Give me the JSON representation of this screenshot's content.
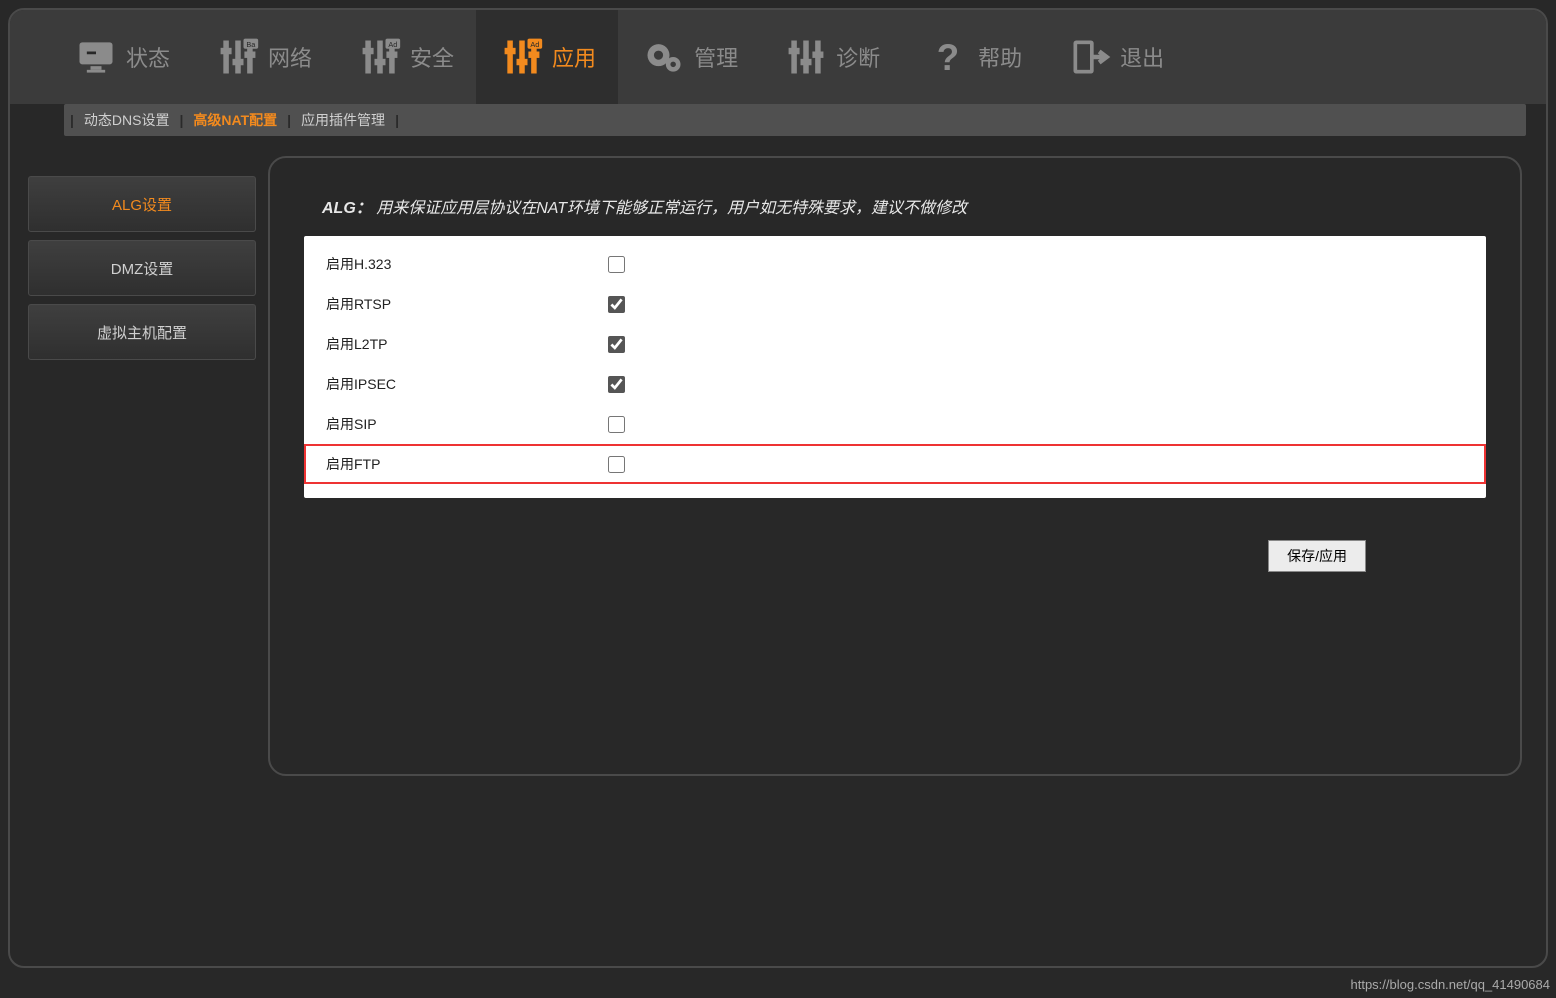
{
  "topnav": [
    {
      "label": "状态",
      "icon": "monitor"
    },
    {
      "label": "网络",
      "icon": "sliders-ba"
    },
    {
      "label": "安全",
      "icon": "sliders-ad"
    },
    {
      "label": "应用",
      "icon": "sliders-ad",
      "active": true
    },
    {
      "label": "管理",
      "icon": "gears"
    },
    {
      "label": "诊断",
      "icon": "sliders"
    },
    {
      "label": "帮助",
      "icon": "question"
    },
    {
      "label": "退出",
      "icon": "exit"
    }
  ],
  "subnav": [
    {
      "label": "动态DNS设置"
    },
    {
      "label": "高级NAT配置",
      "active": true
    },
    {
      "label": "应用插件管理"
    }
  ],
  "sidebar": [
    {
      "label": "ALG设置",
      "active": true
    },
    {
      "label": "DMZ设置"
    },
    {
      "label": "虚拟主机配置"
    }
  ],
  "hint_prefix": "ALG：",
  "hint_body": "用来保证应用层协议在NAT环境下能够正常运行，用户如无特殊要求，建议不做修改",
  "options": [
    {
      "label": "启用H.323",
      "checked": false
    },
    {
      "label": "启用RTSP",
      "checked": true
    },
    {
      "label": "启用L2TP",
      "checked": true
    },
    {
      "label": "启用IPSEC",
      "checked": true
    },
    {
      "label": "启用SIP",
      "checked": false
    },
    {
      "label": "启用FTP",
      "checked": false,
      "highlight": true
    }
  ],
  "save_label": "保存/应用",
  "watermark": "https://blog.csdn.net/qq_41490684"
}
